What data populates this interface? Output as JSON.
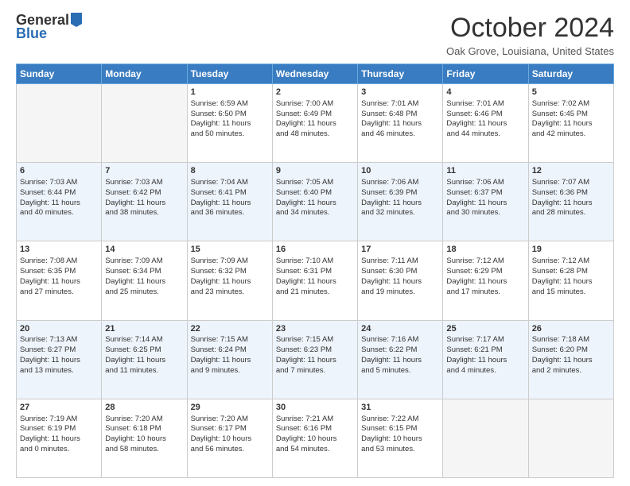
{
  "logo": {
    "general": "General",
    "blue": "Blue"
  },
  "title": "October 2024",
  "location": "Oak Grove, Louisiana, United States",
  "days_of_week": [
    "Sunday",
    "Monday",
    "Tuesday",
    "Wednesday",
    "Thursday",
    "Friday",
    "Saturday"
  ],
  "weeks": [
    [
      {
        "day": "",
        "info": ""
      },
      {
        "day": "",
        "info": ""
      },
      {
        "day": "1",
        "info": "Sunrise: 6:59 AM\nSunset: 6:50 PM\nDaylight: 11 hours\nand 50 minutes."
      },
      {
        "day": "2",
        "info": "Sunrise: 7:00 AM\nSunset: 6:49 PM\nDaylight: 11 hours\nand 48 minutes."
      },
      {
        "day": "3",
        "info": "Sunrise: 7:01 AM\nSunset: 6:48 PM\nDaylight: 11 hours\nand 46 minutes."
      },
      {
        "day": "4",
        "info": "Sunrise: 7:01 AM\nSunset: 6:46 PM\nDaylight: 11 hours\nand 44 minutes."
      },
      {
        "day": "5",
        "info": "Sunrise: 7:02 AM\nSunset: 6:45 PM\nDaylight: 11 hours\nand 42 minutes."
      }
    ],
    [
      {
        "day": "6",
        "info": "Sunrise: 7:03 AM\nSunset: 6:44 PM\nDaylight: 11 hours\nand 40 minutes."
      },
      {
        "day": "7",
        "info": "Sunrise: 7:03 AM\nSunset: 6:42 PM\nDaylight: 11 hours\nand 38 minutes."
      },
      {
        "day": "8",
        "info": "Sunrise: 7:04 AM\nSunset: 6:41 PM\nDaylight: 11 hours\nand 36 minutes."
      },
      {
        "day": "9",
        "info": "Sunrise: 7:05 AM\nSunset: 6:40 PM\nDaylight: 11 hours\nand 34 minutes."
      },
      {
        "day": "10",
        "info": "Sunrise: 7:06 AM\nSunset: 6:39 PM\nDaylight: 11 hours\nand 32 minutes."
      },
      {
        "day": "11",
        "info": "Sunrise: 7:06 AM\nSunset: 6:37 PM\nDaylight: 11 hours\nand 30 minutes."
      },
      {
        "day": "12",
        "info": "Sunrise: 7:07 AM\nSunset: 6:36 PM\nDaylight: 11 hours\nand 28 minutes."
      }
    ],
    [
      {
        "day": "13",
        "info": "Sunrise: 7:08 AM\nSunset: 6:35 PM\nDaylight: 11 hours\nand 27 minutes."
      },
      {
        "day": "14",
        "info": "Sunrise: 7:09 AM\nSunset: 6:34 PM\nDaylight: 11 hours\nand 25 minutes."
      },
      {
        "day": "15",
        "info": "Sunrise: 7:09 AM\nSunset: 6:32 PM\nDaylight: 11 hours\nand 23 minutes."
      },
      {
        "day": "16",
        "info": "Sunrise: 7:10 AM\nSunset: 6:31 PM\nDaylight: 11 hours\nand 21 minutes."
      },
      {
        "day": "17",
        "info": "Sunrise: 7:11 AM\nSunset: 6:30 PM\nDaylight: 11 hours\nand 19 minutes."
      },
      {
        "day": "18",
        "info": "Sunrise: 7:12 AM\nSunset: 6:29 PM\nDaylight: 11 hours\nand 17 minutes."
      },
      {
        "day": "19",
        "info": "Sunrise: 7:12 AM\nSunset: 6:28 PM\nDaylight: 11 hours\nand 15 minutes."
      }
    ],
    [
      {
        "day": "20",
        "info": "Sunrise: 7:13 AM\nSunset: 6:27 PM\nDaylight: 11 hours\nand 13 minutes."
      },
      {
        "day": "21",
        "info": "Sunrise: 7:14 AM\nSunset: 6:25 PM\nDaylight: 11 hours\nand 11 minutes."
      },
      {
        "day": "22",
        "info": "Sunrise: 7:15 AM\nSunset: 6:24 PM\nDaylight: 11 hours\nand 9 minutes."
      },
      {
        "day": "23",
        "info": "Sunrise: 7:15 AM\nSunset: 6:23 PM\nDaylight: 11 hours\nand 7 minutes."
      },
      {
        "day": "24",
        "info": "Sunrise: 7:16 AM\nSunset: 6:22 PM\nDaylight: 11 hours\nand 5 minutes."
      },
      {
        "day": "25",
        "info": "Sunrise: 7:17 AM\nSunset: 6:21 PM\nDaylight: 11 hours\nand 4 minutes."
      },
      {
        "day": "26",
        "info": "Sunrise: 7:18 AM\nSunset: 6:20 PM\nDaylight: 11 hours\nand 2 minutes."
      }
    ],
    [
      {
        "day": "27",
        "info": "Sunrise: 7:19 AM\nSunset: 6:19 PM\nDaylight: 11 hours\nand 0 minutes."
      },
      {
        "day": "28",
        "info": "Sunrise: 7:20 AM\nSunset: 6:18 PM\nDaylight: 10 hours\nand 58 minutes."
      },
      {
        "day": "29",
        "info": "Sunrise: 7:20 AM\nSunset: 6:17 PM\nDaylight: 10 hours\nand 56 minutes."
      },
      {
        "day": "30",
        "info": "Sunrise: 7:21 AM\nSunset: 6:16 PM\nDaylight: 10 hours\nand 54 minutes."
      },
      {
        "day": "31",
        "info": "Sunrise: 7:22 AM\nSunset: 6:15 PM\nDaylight: 10 hours\nand 53 minutes."
      },
      {
        "day": "",
        "info": ""
      },
      {
        "day": "",
        "info": ""
      }
    ]
  ]
}
